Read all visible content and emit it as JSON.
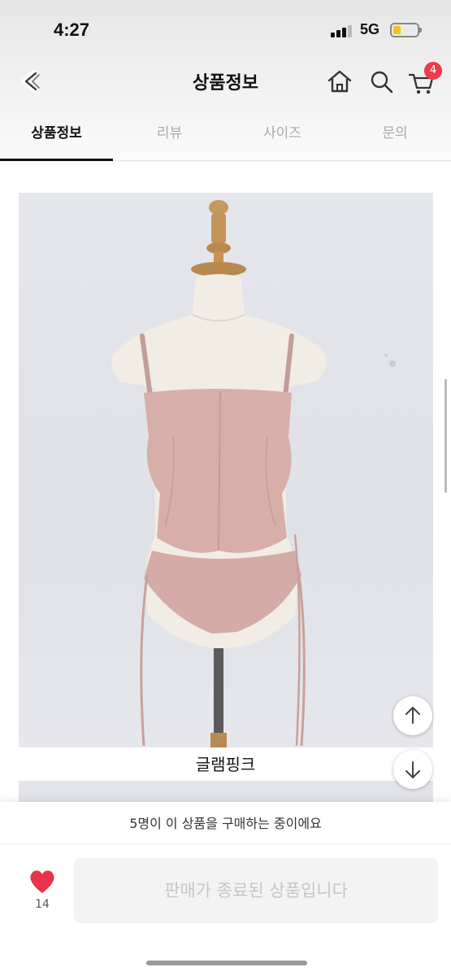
{
  "status_bar": {
    "time": "4:27",
    "network": "5G"
  },
  "header": {
    "title": "상품정보",
    "cart_count": "4"
  },
  "tabs": [
    {
      "label": "상품정보",
      "active": true
    },
    {
      "label": "리뷰",
      "active": false
    },
    {
      "label": "사이즈",
      "active": false
    },
    {
      "label": "문의",
      "active": false
    }
  ],
  "product": {
    "caption": "글램핑크"
  },
  "bottom": {
    "purchase_banner": "5명이 이 상품을 구매하는 중이에요",
    "like_count": "14",
    "action_label": "판매가 종료된 상품입니다"
  },
  "colors": {
    "accent": "#ee3a4a",
    "heart": "#e8334a",
    "garment": "#d6aba6"
  },
  "icons": [
    "back-icon",
    "home-icon",
    "search-icon",
    "cart-icon",
    "arrow-up-icon",
    "arrow-down-icon",
    "heart-icon"
  ]
}
